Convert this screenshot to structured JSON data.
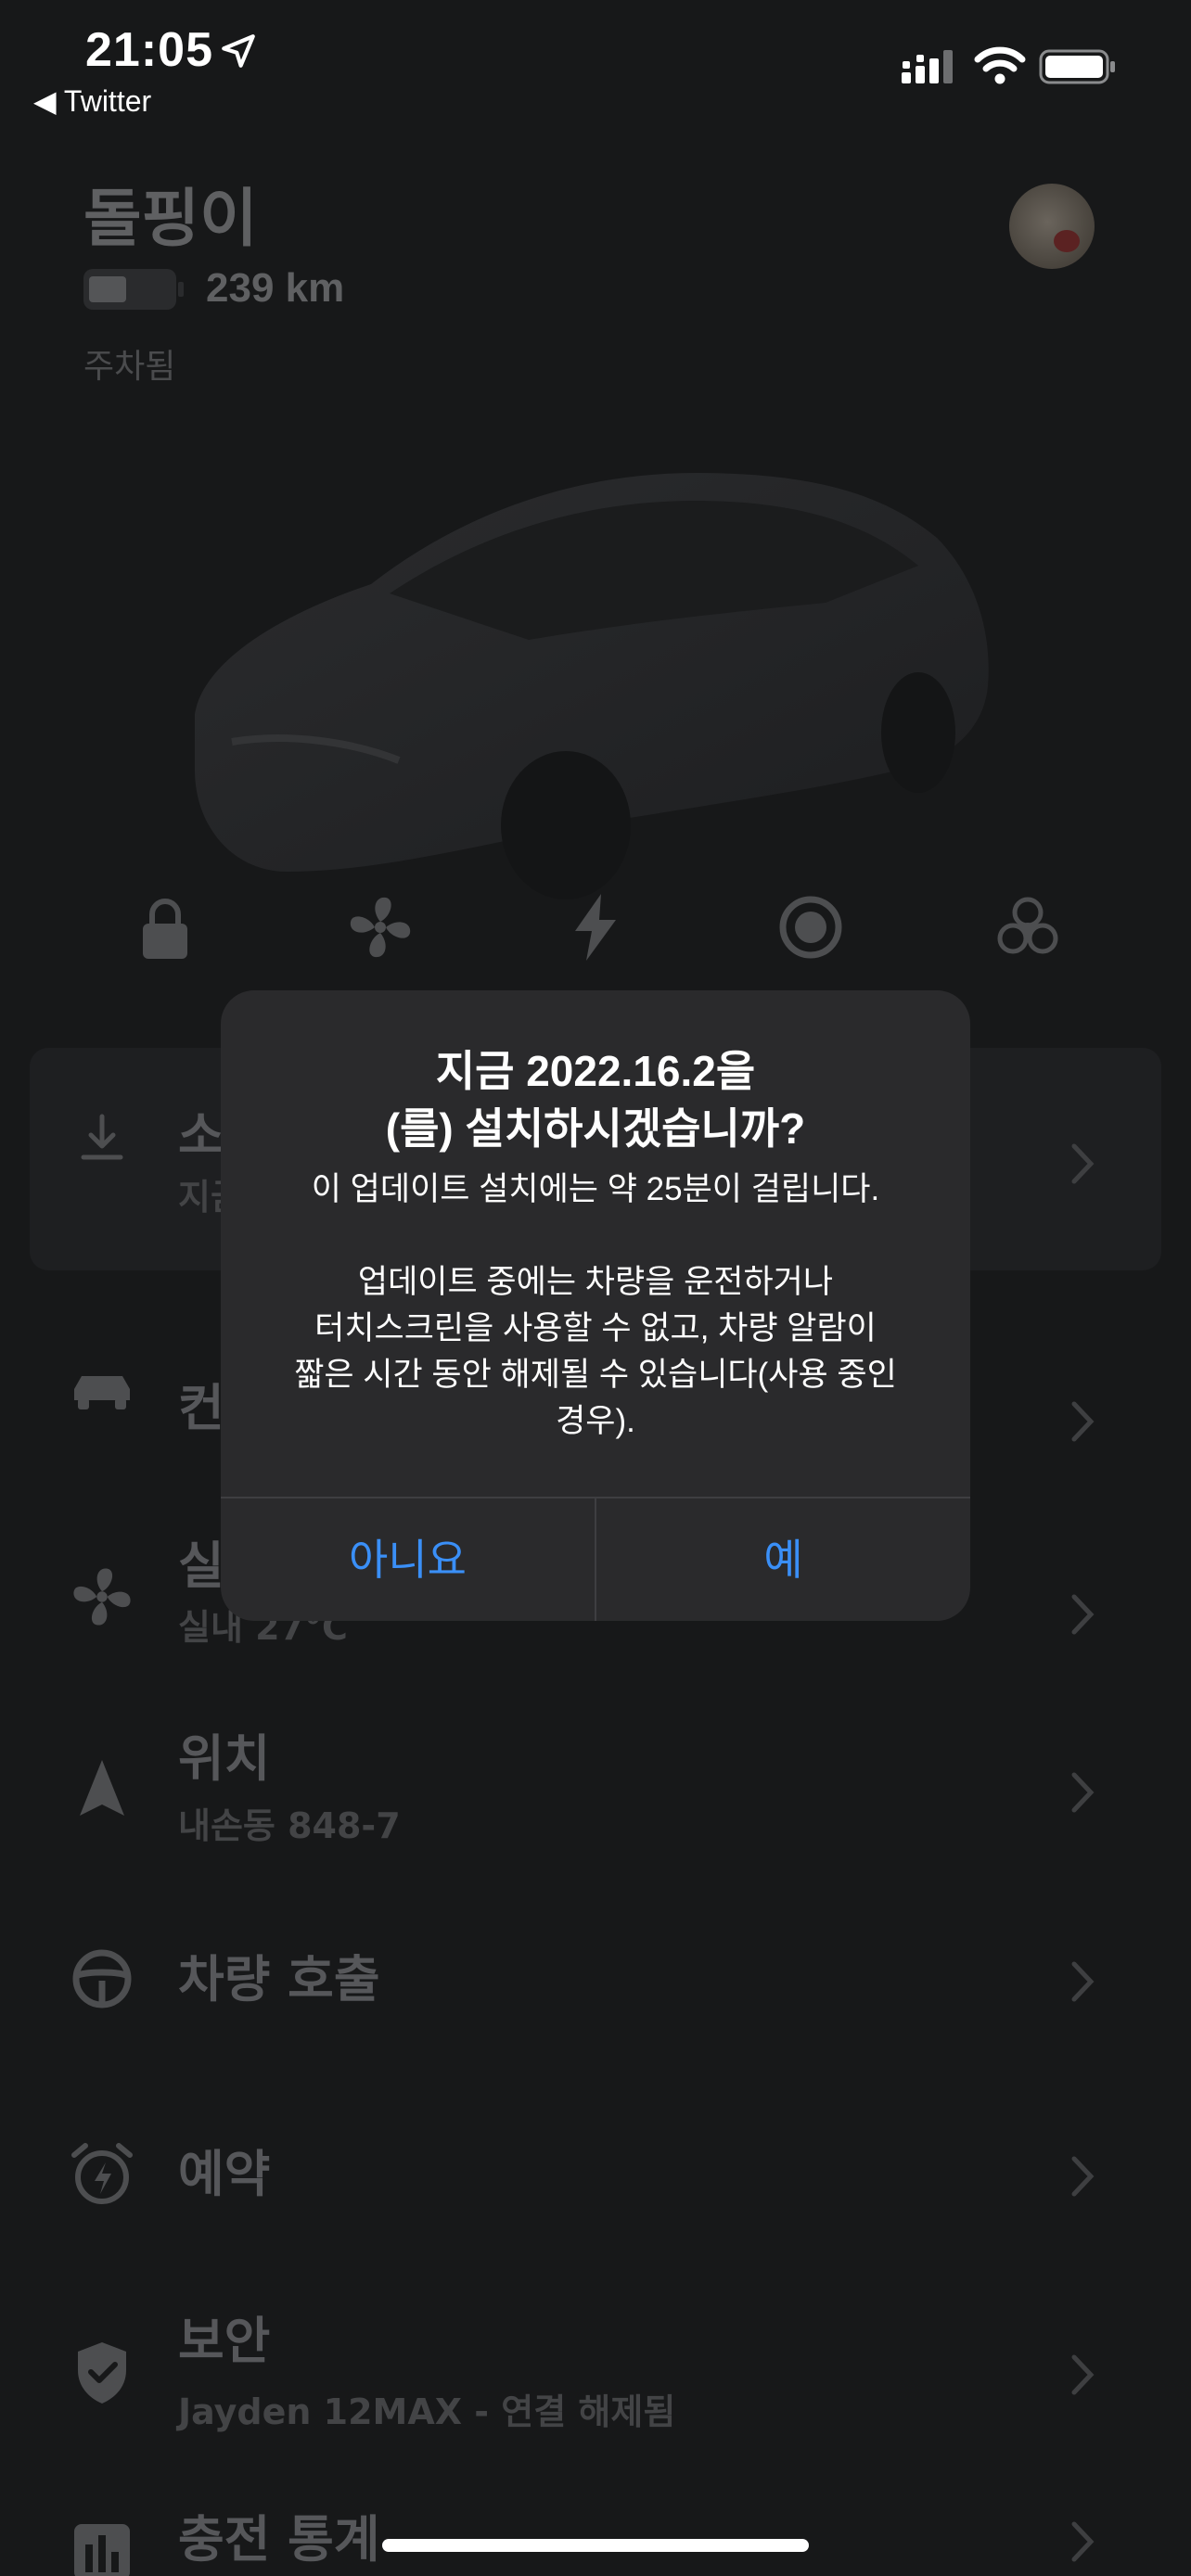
{
  "status_bar": {
    "time": "21:05",
    "back_label": "◀ Twitter"
  },
  "vehicle": {
    "name": "돌핑이",
    "range": "239 km",
    "state": "주차됨",
    "battery_level_fraction": 0.4
  },
  "quick_controls": [
    "lock-icon",
    "fan-icon",
    "bolt-icon",
    "sentry-icon",
    "biohazard-icon"
  ],
  "menu": {
    "software": {
      "title": "소",
      "sub": "지금"
    },
    "controls": {
      "title": "컨"
    },
    "climate": {
      "title": "실",
      "sub": "실내 27°C"
    },
    "location": {
      "title": "위치",
      "sub": "내손동 848-7"
    },
    "summon": {
      "title": "차량 호출"
    },
    "schedule": {
      "title": "예약"
    },
    "security": {
      "title": "보안",
      "sub": "Jayden 12MAX - 연결 해제됨"
    },
    "charging_stats": {
      "title": "충전 통계"
    }
  },
  "dialog": {
    "title": "지금 2022.16.2을\n(를) 설치하시겠습니까?",
    "message": "이 업데이트 설치에는 약 25분이 걸립니다.\n\n업데이트 중에는 차량을 운전하거나\n터치스크린을 사용할 수 없고, 차량 알람이\n짧은 시간 동안 해제될 수 있습니다(사용 중인\n경우).",
    "no_label": "아니요",
    "yes_label": "예"
  },
  "colors": {
    "background": "#171819",
    "dialog_bg": "#2a2a2c",
    "accent_blue": "#3a8ff7"
  }
}
